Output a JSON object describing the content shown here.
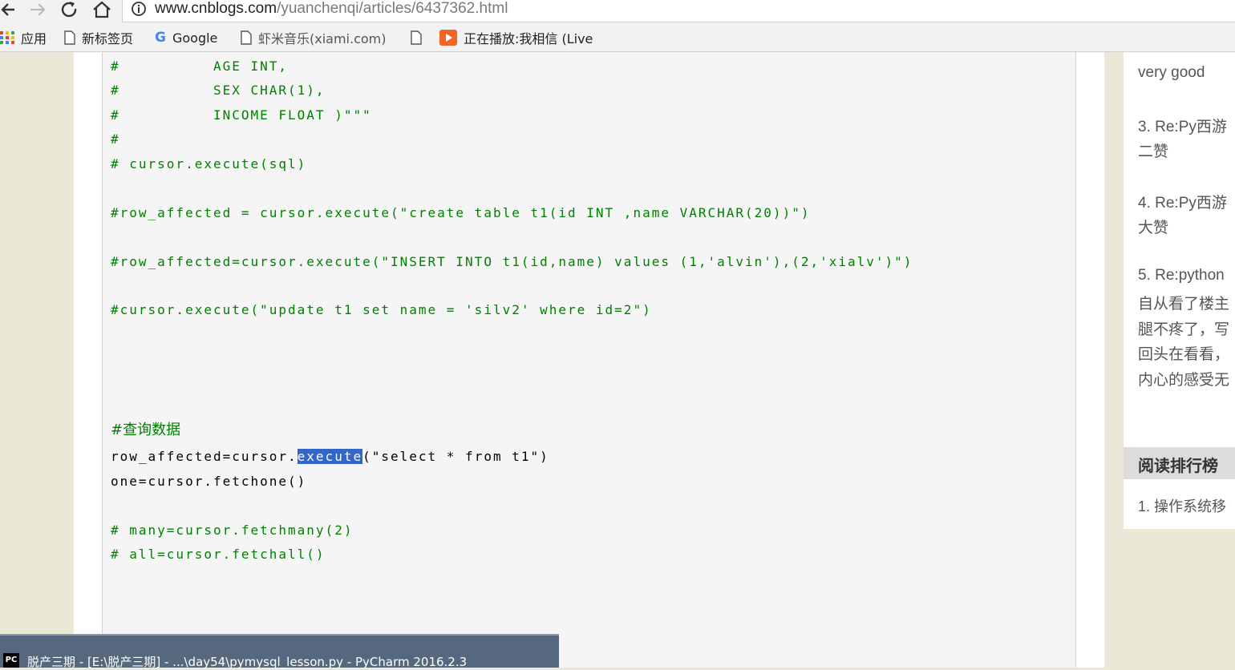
{
  "browser": {
    "url_host": "www.cnblogs.com",
    "url_path": "/yuanchenqi/articles/6437362.html"
  },
  "bookmarks": [
    {
      "label": "应用",
      "icon": "apps-grid-icon"
    },
    {
      "label": "新标签页",
      "icon": "page-icon"
    },
    {
      "label": "Google",
      "icon": "google-icon"
    },
    {
      "label": "虾米音乐(xiami.com)",
      "icon": "page-icon"
    },
    {
      "label": "",
      "icon": "page-icon"
    },
    {
      "label": "正在播放:我相信 (Live",
      "icon": "play-icon"
    }
  ],
  "code": {
    "lines": [
      "#          AGE INT,",
      "#          SEX CHAR(1),",
      "#          INCOME FLOAT )\"\"\"",
      "#",
      "# cursor.execute(sql)",
      "#row_affected = cursor.execute(\"create table t1(id INT ,name VARCHAR(20))\")",
      "#row_affected=cursor.execute(\"INSERT INTO t1(id,name) values (1,'alvin'),(2,'xialv')\")",
      "#cursor.execute(\"update t1 set name = 'silv2' where id=2\")",
      "#查询数据",
      "row_affected=cursor.",
      "execute",
      "(\"select * from t1\")",
      "one=cursor.fetchone()",
      "# many=cursor.fetchmany(2)",
      "# all=cursor.fetchall()"
    ]
  },
  "sidebar": {
    "comments": [
      "very good",
      "3. Re:Py西游",
      "二赞",
      "4. Re:Py西游",
      "大赞",
      "5. Re:python",
      "自从看了楼主",
      "腿不疼了，写",
      "回头在看看，",
      "内心的感受无"
    ],
    "rank_title": "阅读排行榜",
    "rank_items": [
      "1. 操作系统移"
    ]
  },
  "taskbar": {
    "app_badge": "PC",
    "title": "脱产三期 - [E:\\脱产三期] - ...\\day54\\pymysql_lesson.py - PyCharm 2016.2.3"
  }
}
